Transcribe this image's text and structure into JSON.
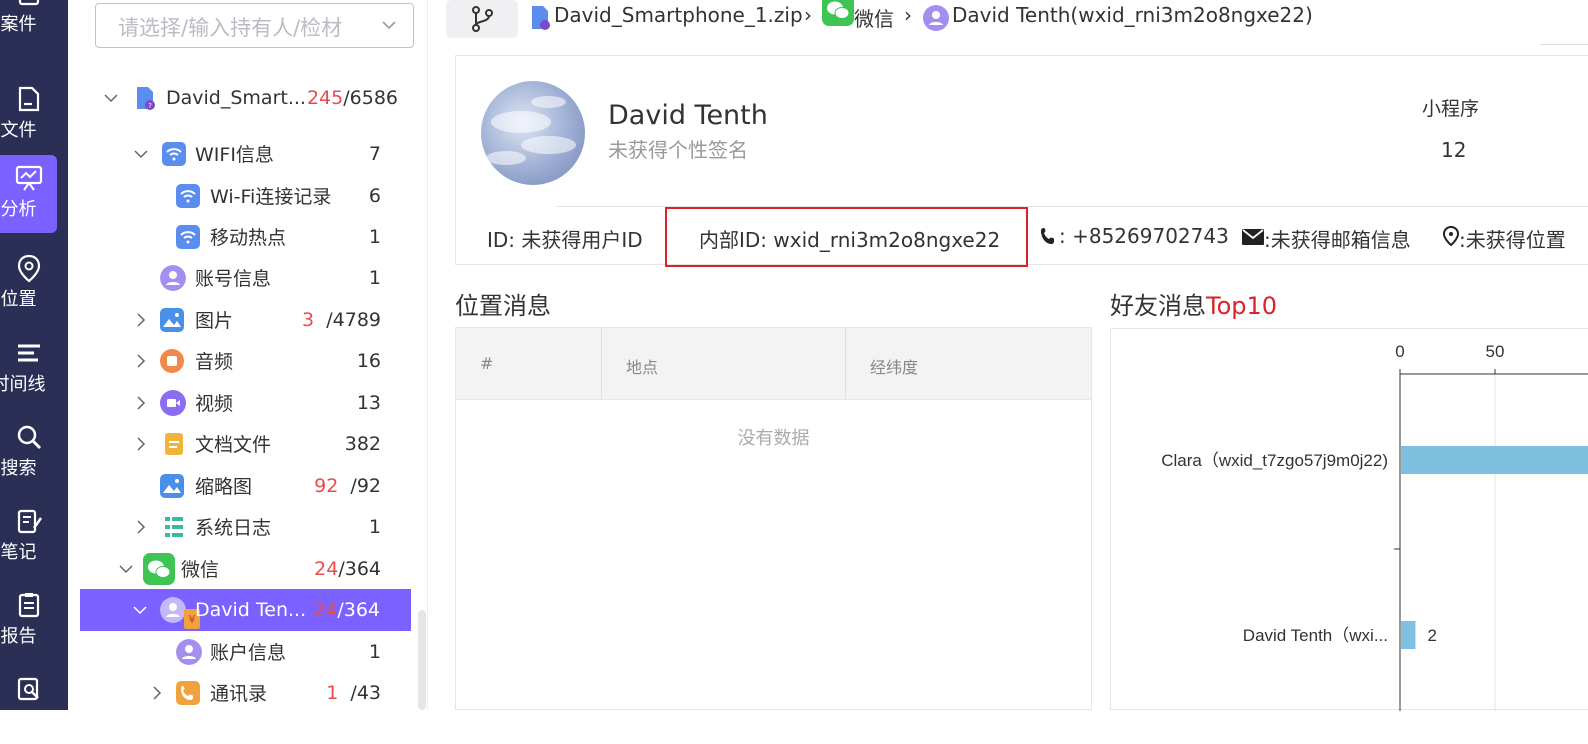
{
  "nav": {
    "items": [
      {
        "label": "案件",
        "icon": "case-icon"
      },
      {
        "label": "文件",
        "icon": "file-icon"
      },
      {
        "label": "分析",
        "icon": "analysis-icon",
        "active": true
      },
      {
        "label": "位置",
        "icon": "location-icon"
      },
      {
        "label": "时间线",
        "icon": "timeline-icon"
      },
      {
        "label": "搜索",
        "icon": "search-icon"
      },
      {
        "label": "笔记",
        "icon": "notes-icon"
      },
      {
        "label": "报告",
        "icon": "report-icon"
      },
      {
        "label": "",
        "icon": "inspect-icon"
      }
    ]
  },
  "tree": {
    "search_placeholder": "请选择/输入持有人/检材",
    "root": {
      "label": "David_Smart...",
      "red": "245",
      "total": "/6586"
    },
    "rows": [
      {
        "label": "WIFI信息",
        "count": "7"
      },
      {
        "label": "Wi-Fi连接记录",
        "count": "6"
      },
      {
        "label": "移动热点",
        "count": "1"
      },
      {
        "label": "账号信息",
        "count": "1"
      },
      {
        "label": "图片",
        "red": "3",
        "total": "/4789"
      },
      {
        "label": "音频",
        "count": "16"
      },
      {
        "label": "视频",
        "count": "13"
      },
      {
        "label": "文档文件",
        "count": "382"
      },
      {
        "label": "缩略图",
        "red": "92",
        "total": "/92"
      },
      {
        "label": "系统日志",
        "count": "1"
      },
      {
        "label": "微信",
        "red": "24",
        "total": "/364"
      },
      {
        "label": "David Ten...",
        "red": "24",
        "total": "/364"
      },
      {
        "label": "账户信息",
        "count": "1"
      },
      {
        "label": "通讯录",
        "red": "1",
        "total": "/43"
      }
    ]
  },
  "breadcrumb": {
    "file": "David_Smartphone_1.zip",
    "app": "微信",
    "user": "David Tenth(wxid_rni3m2o8ngxe22)"
  },
  "profile": {
    "name": "David Tenth",
    "signature": "未获得个性签名",
    "mini_program_label": "小程序",
    "mini_program_count": "12",
    "id": "ID: 未获得用户ID",
    "internal_id": "内部ID: wxid_rni3m2o8ngxe22",
    "phone": ": +85269702743",
    "email": ":未获得邮箱信息",
    "location": ":未获得位置"
  },
  "location_section": {
    "title": "位置消息",
    "columns": [
      "#",
      "地点",
      "经纬度"
    ],
    "empty_text": "没有数据"
  },
  "friends_section": {
    "title_main": "好友消息",
    "title_accent": "Top10"
  },
  "chart_data": {
    "type": "bar",
    "orientation": "horizontal",
    "categories": [
      "Clara（wxid_t7zgo57j9m0j22)",
      "David Tenth（wxi..."
    ],
    "values": [
      null,
      2
    ],
    "x_ticks": [
      "0",
      "50"
    ],
    "x_tick_values": [
      0,
      50
    ],
    "data_labels": [
      "",
      "2"
    ],
    "bar_color": "#7fbfe0"
  },
  "colors": {
    "accent": "#7b61ff",
    "highlight": "#d8232a",
    "rail": "#2b2f55",
    "red_count": "#e84b4b"
  }
}
